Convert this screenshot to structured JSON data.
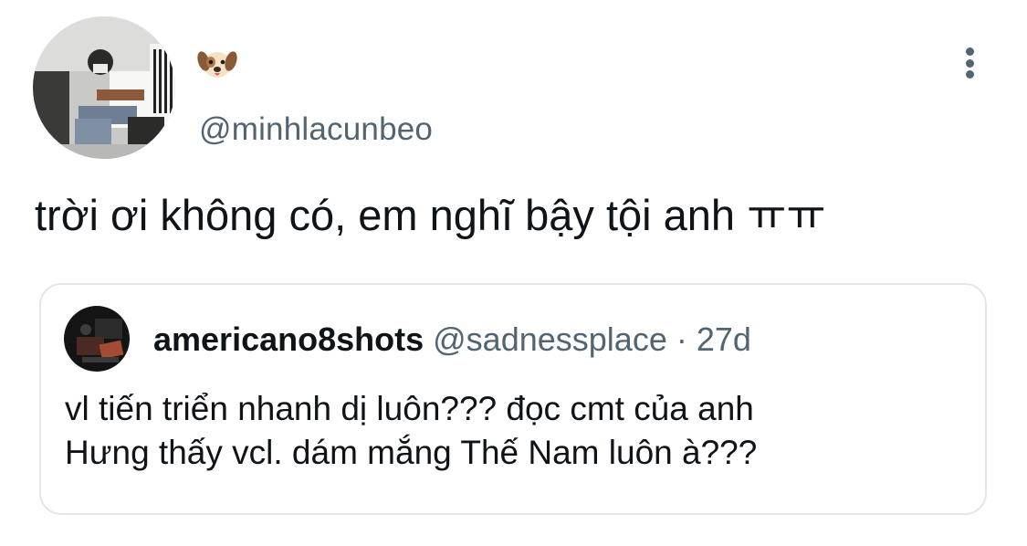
{
  "author": {
    "avatar_icon": "user-avatar-photo",
    "display_name_icon": "dog-face-emoji",
    "handle": "@minhlacunbeo"
  },
  "menu": {
    "icon": "more-vertical-icon"
  },
  "tweet": {
    "text": "trời ơi không có, em nghĩ bậy tội anh ㅠㅠ"
  },
  "quote": {
    "avatar_icon": "quoted-user-avatar-photo",
    "name": "americano8shots",
    "handle": "@sadnessplace",
    "separator": "·",
    "time": "27d",
    "lines": [
      "vl tiến triển nhanh dị luôn??? đọc cmt của anh",
      "Hưng thấy vcl. dám mắng Thế Nam luôn à???"
    ]
  },
  "colors": {
    "text": "#0f1419",
    "secondary": "#536471",
    "border": "#e3e7ea"
  }
}
